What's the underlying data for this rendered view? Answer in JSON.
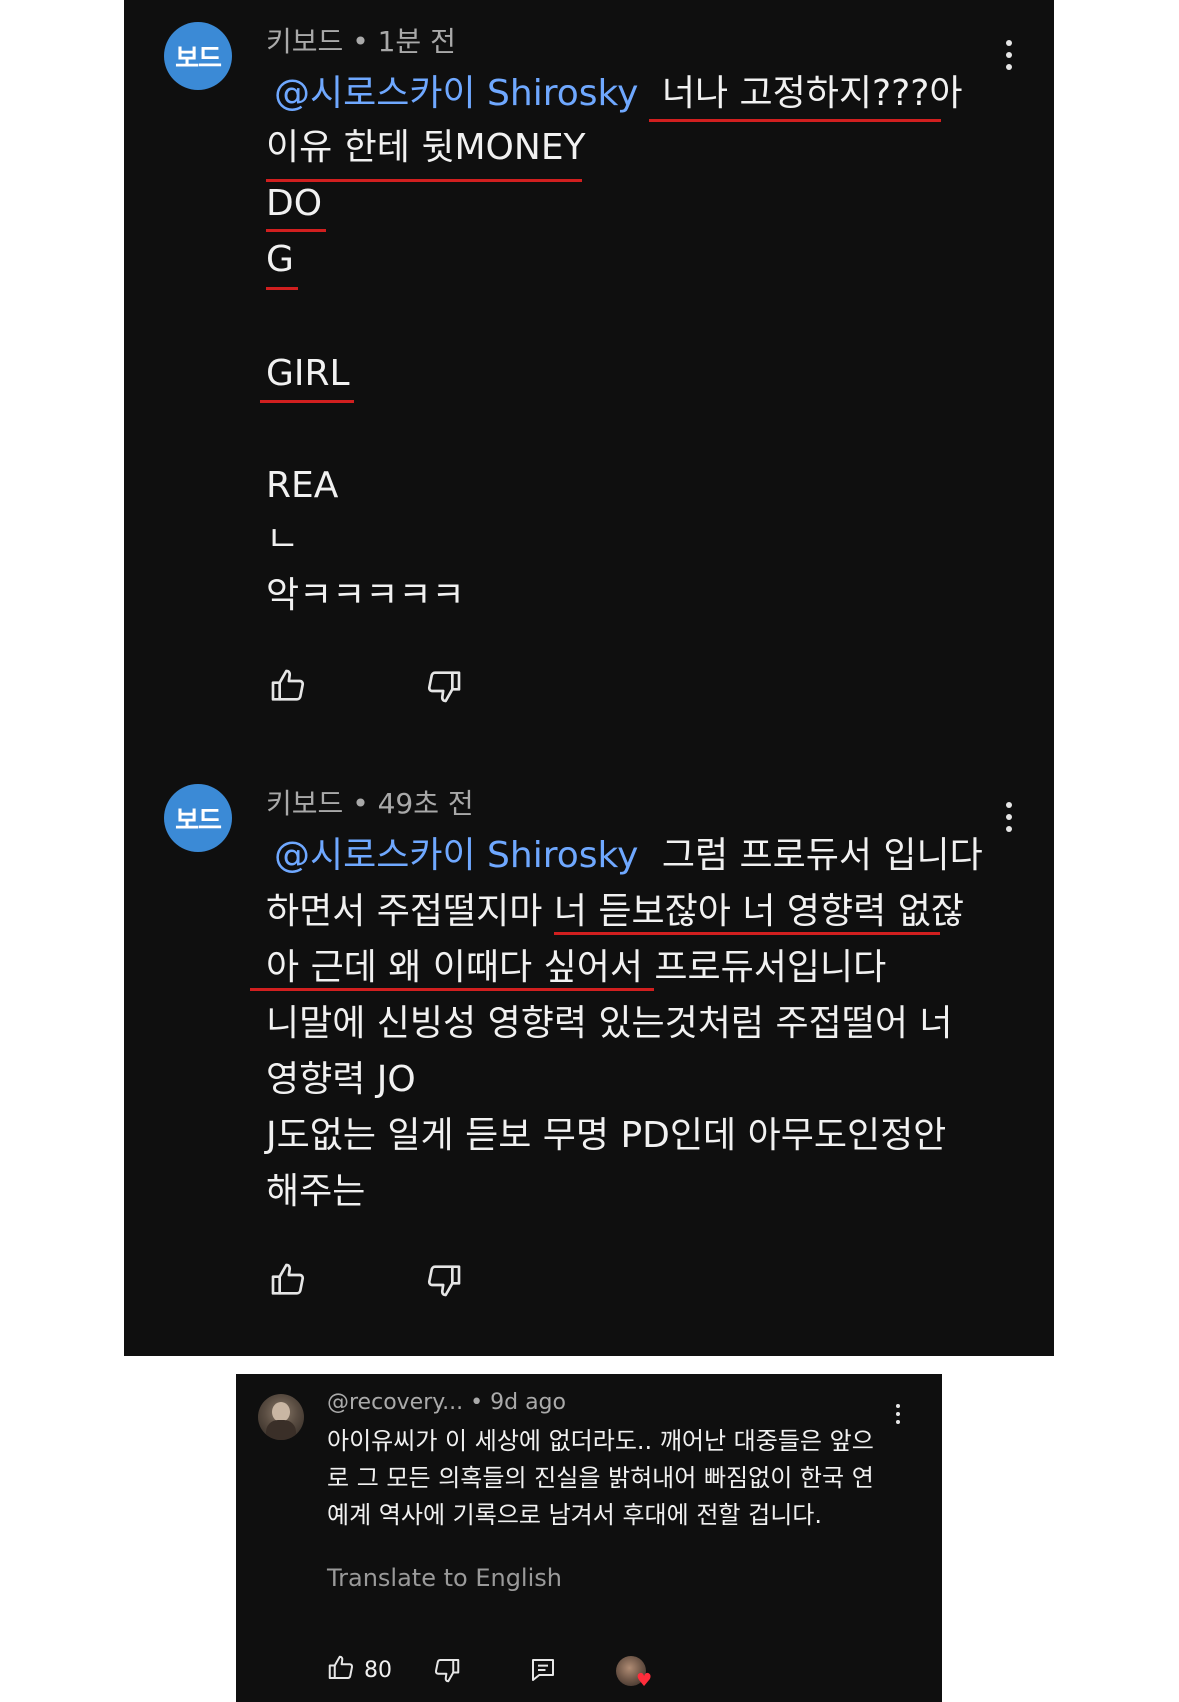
{
  "comment1": {
    "avatar_text": "보드",
    "author": "키보드",
    "time": "1분 전",
    "mention": "@시로스카이 Shirosky",
    "lines": [
      "너나 고정하지???아",
      "이유 한테 뒷MONEY",
      "DO",
      "G",
      "GIRL",
      "REA",
      "ㄴ",
      "악ㅋㅋㅋㅋㅋ"
    ]
  },
  "comment2": {
    "avatar_text": "보드",
    "author": "키보드",
    "time": "49초 전",
    "mention": "@시로스카이 Shirosky",
    "lines": [
      "그럼 프로듀서 입니다",
      "하면서 주접떨지마 너 듣보잖아 너 영향력 없잖",
      "아 근데 왜 이때다 싶어서 프로듀서입니다",
      "니말에 신빙성 영향력 있는것처럼 주접떨어 너",
      "영향력 JO",
      "J도없는 일게 듣보 무명 PD인데 아무도인정안",
      "해주는"
    ]
  },
  "comment3": {
    "author": "@recovery...",
    "time": "9d ago",
    "lines": [
      "아이유씨가 이 세상에 없더라도.. 깨어난 대중들은 앞으",
      "로 그 모든 의혹들의 진실을 밝혀내어 빠짐없이 한국 연",
      "예계 역사에 기록으로 남겨서 후대에 전할 겁니다."
    ],
    "translate_label": "Translate to English",
    "like_count": "80"
  },
  "icons": {
    "like": "thumbs-up-icon",
    "dislike": "thumbs-down-icon",
    "reply": "reply-icon",
    "more": "more-vert-icon",
    "creator_heart": "heart-icon"
  },
  "colors": {
    "background": "#0f0f0f",
    "mention": "#6fa8ff",
    "avatar": "#3b8ad6",
    "underline": "#d11f1f",
    "heart": "#ff2d3b"
  }
}
